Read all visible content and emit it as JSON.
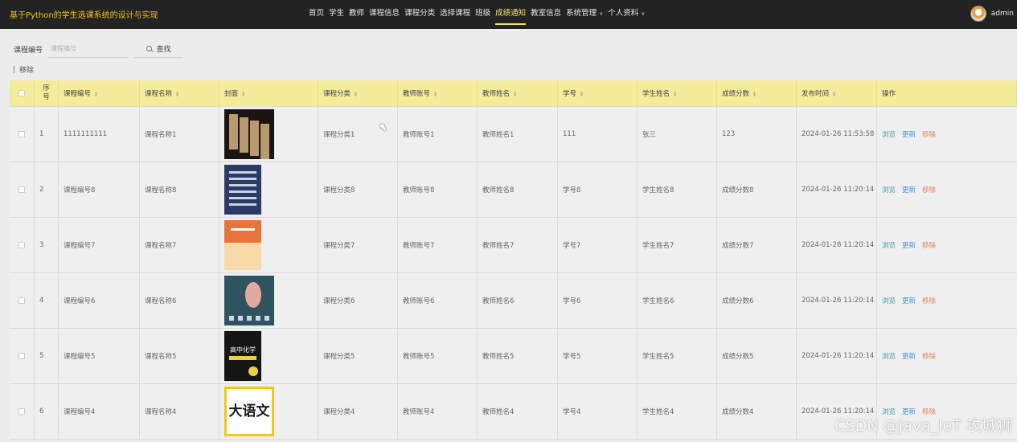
{
  "app": {
    "title": "基于Python的学生选课系统的设计与实现"
  },
  "nav": {
    "items": [
      {
        "label": "首页"
      },
      {
        "label": "学生"
      },
      {
        "label": "教师"
      },
      {
        "label": "课程信息"
      },
      {
        "label": "课程分类"
      },
      {
        "label": "选择课程"
      },
      {
        "label": "班级"
      },
      {
        "label": "成绩通知",
        "active": true
      },
      {
        "label": "教室信息"
      },
      {
        "label": "系统管理",
        "dropdown": true
      },
      {
        "label": "个人资料",
        "dropdown": true
      }
    ],
    "user": "admin"
  },
  "search": {
    "label": "课程编号",
    "placeholder": "课程编号",
    "button": "查找"
  },
  "toolbar": {
    "remove": "移除"
  },
  "table": {
    "headers": [
      "序号",
      "课程编号",
      "课程名称",
      "封面",
      "课程分类",
      "教师账号",
      "教师姓名",
      "学号",
      "学生姓名",
      "成绩分数",
      "发布时间",
      "操作"
    ],
    "actions": {
      "browse": "浏览",
      "update": "更新",
      "remove": "移除"
    },
    "rows": [
      {
        "seq": "1",
        "course_no": "1111111111",
        "course_name": "课程名称1",
        "category": "课程分类1",
        "teacher_account": "教师账号1",
        "teacher_name": "教师姓名1",
        "student_no": "111",
        "student_name": "张三",
        "score": "123",
        "published": "2024-01-26 11:53:58",
        "cover": {
          "bg": "#1c1410",
          "fg": "#b89a72",
          "label": ""
        }
      },
      {
        "seq": "2",
        "course_no": "课程编号8",
        "course_name": "课程名称8",
        "category": "课程分类8",
        "teacher_account": "教师账号8",
        "teacher_name": "教师姓名8",
        "student_no": "学号8",
        "student_name": "学生姓名8",
        "score": "成绩分数8",
        "published": "2024-01-26 11:20:14",
        "cover": {
          "bg": "#2d3a66",
          "fg": "#c9d3e8",
          "label": ""
        }
      },
      {
        "seq": "3",
        "course_no": "课程编号7",
        "course_name": "课程名称7",
        "category": "课程分类7",
        "teacher_account": "教师账号7",
        "teacher_name": "教师姓名7",
        "student_no": "学号7",
        "student_name": "学生姓名7",
        "score": "成绩分数7",
        "published": "2024-01-26 11:20:14",
        "cover": {
          "bg": "#e8743c",
          "fg": "#f8d9a8",
          "label": ""
        }
      },
      {
        "seq": "4",
        "course_no": "课程编号6",
        "course_name": "课程名称6",
        "category": "课程分类6",
        "teacher_account": "教师账号6",
        "teacher_name": "教师姓名6",
        "student_no": "学号6",
        "student_name": "学生姓名6",
        "score": "成绩分数6",
        "published": "2024-01-26 11:20:14",
        "cover": {
          "bg": "#2f5460",
          "fg": "#e3a9a0",
          "label": ""
        }
      },
      {
        "seq": "5",
        "course_no": "课程编号5",
        "course_name": "课程名称5",
        "category": "课程分类5",
        "teacher_account": "教师账号5",
        "teacher_name": "教师姓名5",
        "student_no": "学号5",
        "student_name": "学生姓名5",
        "score": "成绩分数5",
        "published": "2024-01-26 11:20:14",
        "cover": {
          "bg": "#151515",
          "fg": "#f0d04a",
          "label": "高中化学"
        }
      },
      {
        "seq": "6",
        "course_no": "课程编号4",
        "course_name": "课程名称4",
        "category": "课程分类4",
        "teacher_account": "教师账号4",
        "teacher_name": "教师姓名4",
        "student_no": "学号4",
        "student_name": "学生姓名4",
        "score": "成绩分数4",
        "published": "2024-01-26 11:20:14",
        "cover": {
          "bg": "#f5c518",
          "fg": "#1a1a1a",
          "label": "大语文"
        }
      }
    ]
  },
  "watermark": "CSDN @Java_IoT 攻城狮"
}
